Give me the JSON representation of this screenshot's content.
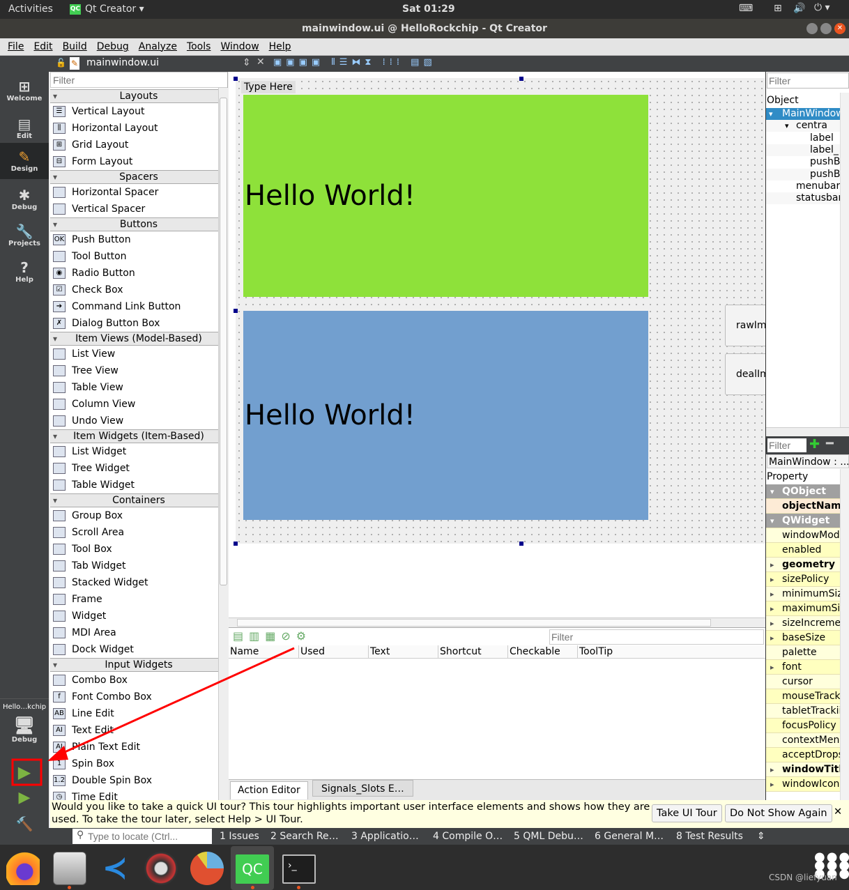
{
  "topbar": {
    "activities": "Activities",
    "app": "Qt Creator",
    "app_icon": "QC",
    "clock": "Sat 01:29"
  },
  "window": {
    "title": "mainwindow.ui @ HelloRockchip - Qt Creator"
  },
  "menu": [
    "File",
    "Edit",
    "Build",
    "Debug",
    "Analyze",
    "Tools",
    "Window",
    "Help"
  ],
  "editor": {
    "file": "mainwindow.ui"
  },
  "modes": [
    {
      "label": "Welcome",
      "icon": "grid-icon"
    },
    {
      "label": "Edit",
      "icon": "document-icon"
    },
    {
      "label": "Design",
      "icon": "pencil-icon"
    },
    {
      "label": "Debug",
      "icon": "bug-icon"
    },
    {
      "label": "Projects",
      "icon": "wrench-icon"
    },
    {
      "label": "Help",
      "icon": "help-icon"
    }
  ],
  "target": {
    "project": "Hello…kchip",
    "config": "Debug"
  },
  "widgetbox": {
    "filter_placeholder": "Filter",
    "sections": [
      {
        "title": "Layouts",
        "items": [
          "Vertical Layout",
          "Horizontal Layout",
          "Grid Layout",
          "Form Layout"
        ]
      },
      {
        "title": "Spacers",
        "items": [
          "Horizontal Spacer",
          "Vertical Spacer"
        ]
      },
      {
        "title": "Buttons",
        "items": [
          "Push Button",
          "Tool Button",
          "Radio Button",
          "Check Box",
          "Command Link Button",
          "Dialog Button Box"
        ]
      },
      {
        "title": "Item Views (Model-Based)",
        "items": [
          "List View",
          "Tree View",
          "Table View",
          "Column View",
          "Undo View"
        ]
      },
      {
        "title": "Item Widgets (Item-Based)",
        "items": [
          "List Widget",
          "Tree Widget",
          "Table Widget"
        ]
      },
      {
        "title": "Containers",
        "items": [
          "Group Box",
          "Scroll Area",
          "Tool Box",
          "Tab Widget",
          "Stacked Widget",
          "Frame",
          "Widget",
          "MDI Area",
          "Dock Widget"
        ]
      },
      {
        "title": "Input Widgets",
        "items": [
          "Combo Box",
          "Font Combo Box",
          "Line Edit",
          "Text Edit",
          "Plain Text Edit",
          "Spin Box",
          "Double Spin Box",
          "Time Edit"
        ]
      }
    ]
  },
  "form": {
    "menu_placeholder": "Type Here",
    "label1": "Hello World!",
    "label2": "Hello World!",
    "label1_color": "#8ee13a",
    "label2_color": "#729fcf",
    "button1": "rawIm",
    "button2": "dealIm"
  },
  "action_editor": {
    "filter_placeholder": "Filter",
    "columns": [
      "Name",
      "Used",
      "Text",
      "Shortcut",
      "Checkable",
      "ToolTip"
    ],
    "tabs": [
      "Action Editor",
      "Signals_Slots E…"
    ]
  },
  "object_inspector": {
    "filter_placeholder": "Filter",
    "header": "Object",
    "tree": [
      {
        "name": "MainWindow",
        "level": 0,
        "selected": true
      },
      {
        "name": "centra",
        "level": 1
      },
      {
        "name": "label",
        "level": 2
      },
      {
        "name": "label_",
        "level": 2
      },
      {
        "name": "pushB",
        "level": 2
      },
      {
        "name": "pushB",
        "level": 2
      },
      {
        "name": "menubar",
        "level": 1
      },
      {
        "name": "statusbar",
        "level": 1
      }
    ]
  },
  "property_editor": {
    "filter_placeholder": "Filter",
    "context": "MainWindow : ...",
    "header": "Property",
    "rows": [
      {
        "name": "QObject",
        "group": true
      },
      {
        "name": "objectName",
        "bold": true,
        "alt": "peach"
      },
      {
        "name": "QWidget",
        "group": true
      },
      {
        "name": "windowMod"
      },
      {
        "name": "enabled"
      },
      {
        "name": "geometry",
        "bold": true,
        "expand": true
      },
      {
        "name": "sizePolicy",
        "expand": true
      },
      {
        "name": "minimumSiz",
        "expand": true
      },
      {
        "name": "maximumSiz",
        "expand": true
      },
      {
        "name": "sizeIncremer",
        "expand": true
      },
      {
        "name": "baseSize",
        "expand": true
      },
      {
        "name": "palette"
      },
      {
        "name": "font",
        "expand": true
      },
      {
        "name": "cursor"
      },
      {
        "name": "mouseTrack"
      },
      {
        "name": "tabletTrackii"
      },
      {
        "name": "focusPolicy"
      },
      {
        "name": "contextMen"
      },
      {
        "name": "acceptDrops"
      },
      {
        "name": "windowTitle",
        "bold": true,
        "expand": true
      },
      {
        "name": "windowIcon",
        "expand": true
      }
    ]
  },
  "tour": {
    "message": "Would you like to take a quick UI tour? This tour highlights important user interface elements and shows how they are used. To take the tour later, select Help > UI Tour.",
    "take": "Take UI Tour",
    "dismiss": "Do Not Show Again",
    "close": "✕"
  },
  "output": {
    "locator_placeholder": "Type to locate (Ctrl...",
    "tabs": [
      "1  Issues",
      "2  Search Re…",
      "3  Applicatio…",
      "4  Compile O…",
      "5  QML Debu…",
      "6  General M…",
      "8  Test Results"
    ]
  },
  "dock": {
    "apps": [
      "firefox",
      "files",
      "vscode",
      "rhythmbox",
      "chart-app",
      "qt-creator",
      "terminal"
    ],
    "qc_label": "QC"
  },
  "watermark": "CSDN @liefyuan",
  "annotation_color": "#ff0000"
}
